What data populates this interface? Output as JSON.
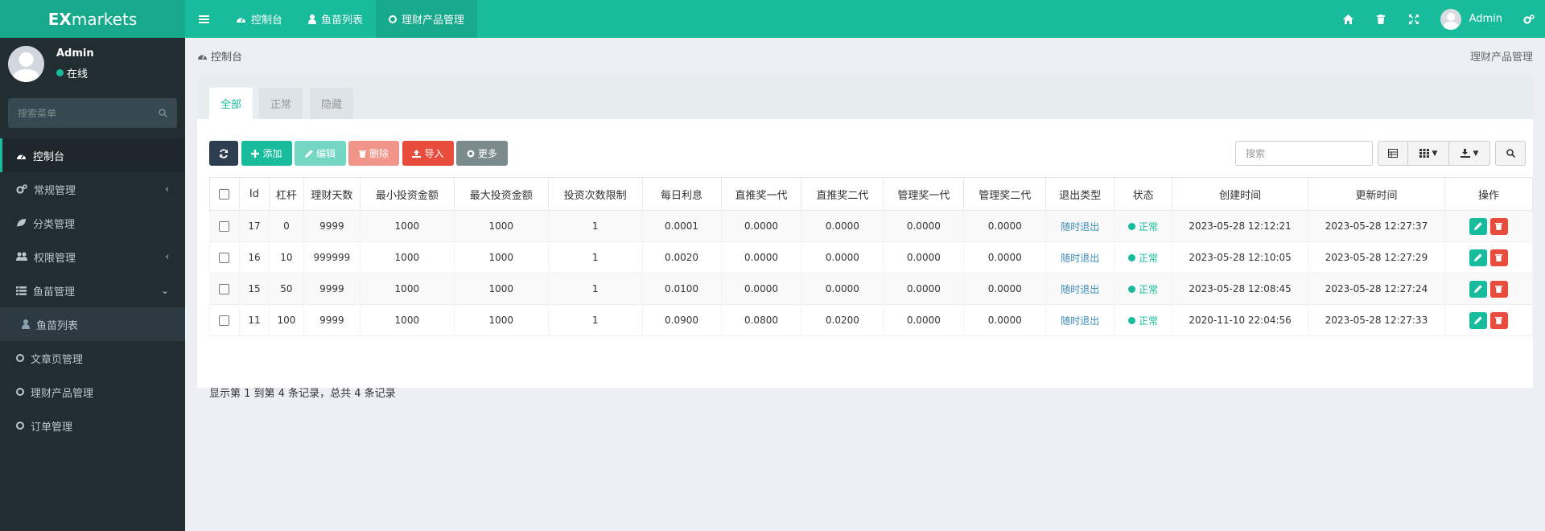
{
  "app": {
    "logo_bold": "EX",
    "logo_rest": "markets"
  },
  "topnav": {
    "tabs": [
      {
        "label": "控制台",
        "icon": "dashboard-icon"
      },
      {
        "label": "鱼苗列表",
        "icon": "user-icon"
      },
      {
        "label": "理财产品管理",
        "icon": "circle-icon"
      }
    ],
    "username": "Admin"
  },
  "sidebar": {
    "username": "Admin",
    "status": "在线",
    "search_placeholder": "搜索菜单",
    "items": [
      {
        "label": "控制台"
      },
      {
        "label": "常规管理"
      },
      {
        "label": "分类管理"
      },
      {
        "label": "权限管理"
      },
      {
        "label": "鱼苗管理"
      },
      {
        "label": "鱼苗列表"
      },
      {
        "label": "文章页管理"
      },
      {
        "label": "理财产品管理"
      },
      {
        "label": "订单管理"
      }
    ]
  },
  "breadcrumb": {
    "left": "控制台",
    "right": "理财产品管理"
  },
  "tabs": [
    "全部",
    "正常",
    "隐藏"
  ],
  "toolbar": {
    "add": "添加",
    "edit": "编辑",
    "delete": "删除",
    "import": "导入",
    "more": "更多",
    "search_placeholder": "搜索"
  },
  "colors": {
    "primary": "#18bc9c",
    "dark": "#2c3e50",
    "danger": "#e74c3c",
    "sidebar": "#222d32"
  },
  "table": {
    "headers": [
      "Id",
      "杠杆",
      "理财天数",
      "最小投资金额",
      "最大投资金额",
      "投资次数限制",
      "每日利息",
      "直推奖一代",
      "直推奖二代",
      "管理奖一代",
      "管理奖二代",
      "退出类型",
      "状态",
      "创建时间",
      "更新时间",
      "操作"
    ],
    "rows": [
      {
        "id": "17",
        "lever": "0",
        "days": "9999",
        "min": "1000",
        "max": "1000",
        "limit": "1",
        "interest": "0.0001",
        "d1": "0.0000",
        "d2": "0.0000",
        "m1": "0.0000",
        "m2": "0.0000",
        "exit": "随时退出",
        "status": "正常",
        "created": "2023-05-28 12:12:21",
        "updated": "2023-05-28 12:27:37"
      },
      {
        "id": "16",
        "lever": "10",
        "days": "999999",
        "min": "1000",
        "max": "1000",
        "limit": "1",
        "interest": "0.0020",
        "d1": "0.0000",
        "d2": "0.0000",
        "m1": "0.0000",
        "m2": "0.0000",
        "exit": "随时退出",
        "status": "正常",
        "created": "2023-05-28 12:10:05",
        "updated": "2023-05-28 12:27:29"
      },
      {
        "id": "15",
        "lever": "50",
        "days": "9999",
        "min": "1000",
        "max": "1000",
        "limit": "1",
        "interest": "0.0100",
        "d1": "0.0000",
        "d2": "0.0000",
        "m1": "0.0000",
        "m2": "0.0000",
        "exit": "随时退出",
        "status": "正常",
        "created": "2023-05-28 12:08:45",
        "updated": "2023-05-28 12:27:24"
      },
      {
        "id": "11",
        "lever": "100",
        "days": "9999",
        "min": "1000",
        "max": "1000",
        "limit": "1",
        "interest": "0.0900",
        "d1": "0.0800",
        "d2": "0.0200",
        "m1": "0.0000",
        "m2": "0.0000",
        "exit": "随时退出",
        "status": "正常",
        "created": "2020-11-10 22:04:56",
        "updated": "2023-05-28 12:27:33"
      }
    ]
  },
  "summary": "显示第 1 到第 4 条记录，总共 4 条记录"
}
